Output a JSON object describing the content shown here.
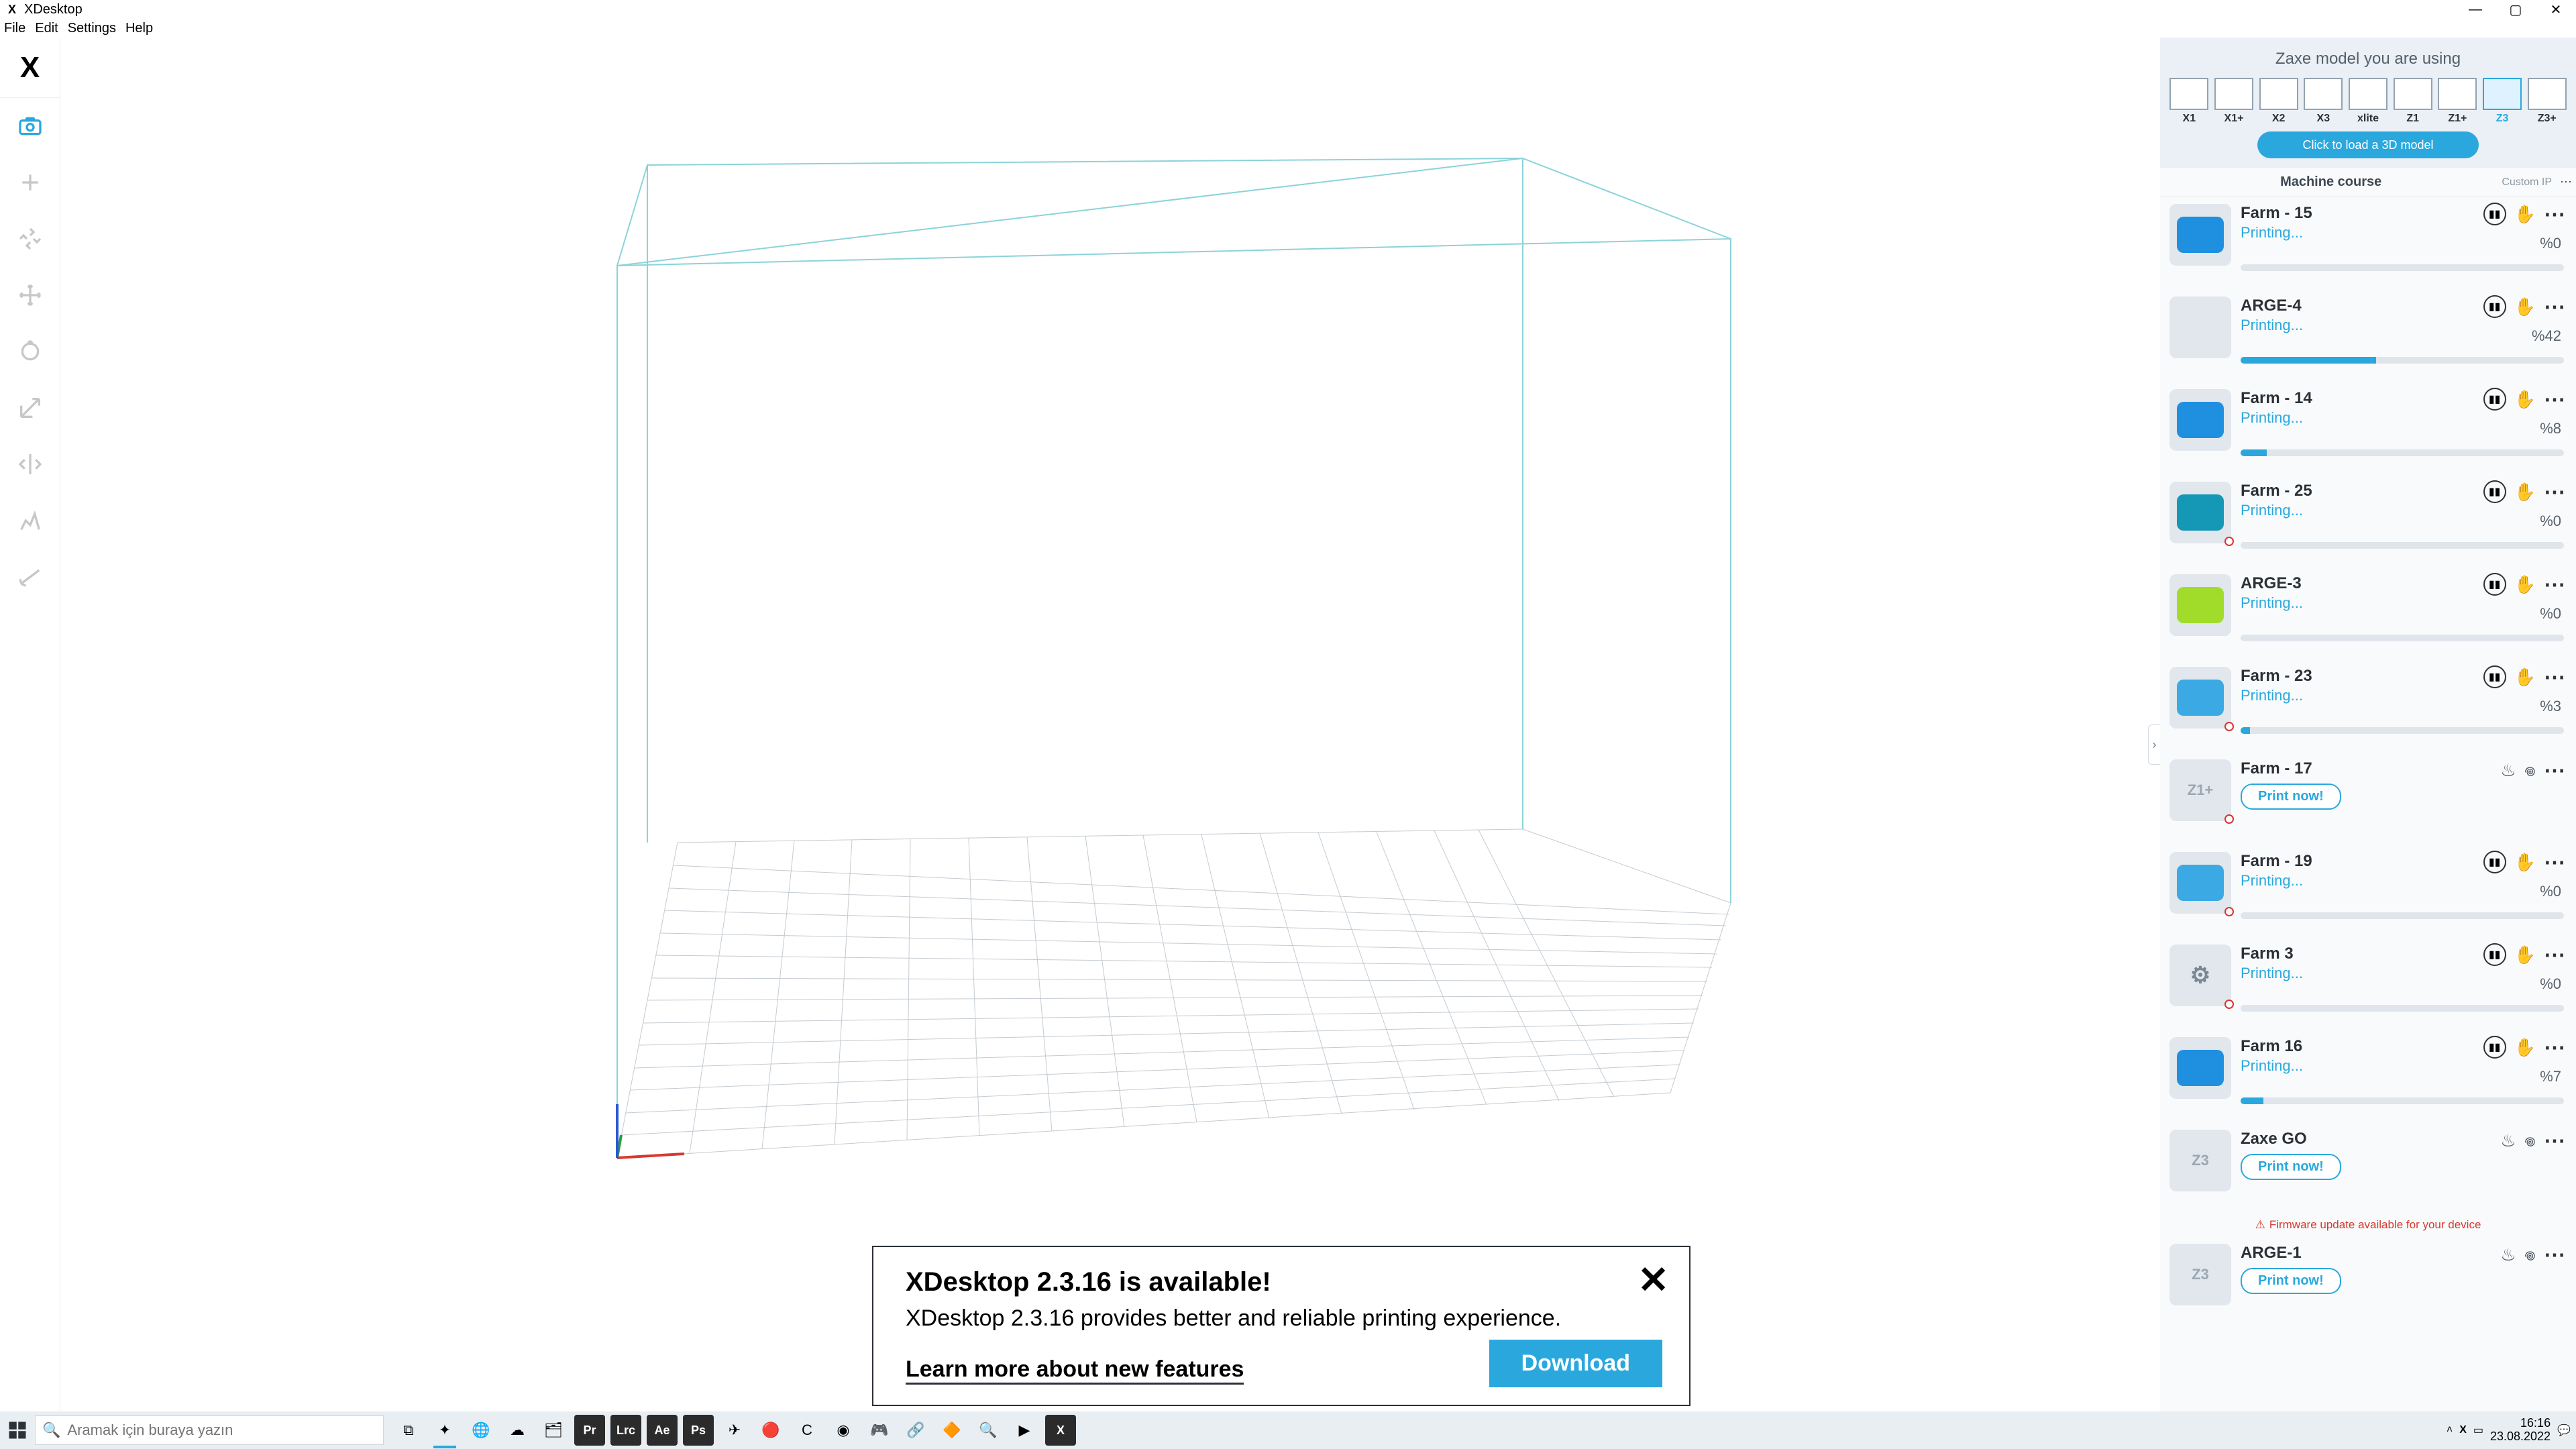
{
  "window": {
    "title": "XDesktop"
  },
  "menu": {
    "file": "File",
    "edit": "Edit",
    "settings": "Settings",
    "help": "Help"
  },
  "sidepanel": {
    "header": "Zaxe model you are using",
    "models": [
      "X1",
      "X1+",
      "X2",
      "X3",
      "xlite",
      "Z1",
      "Z1+",
      "Z3",
      "Z3+"
    ],
    "selected": "Z3",
    "load_button": "Click to load a 3D model",
    "course_label": "Machine course",
    "custom_ip": "Custom IP",
    "print_now": "Print now!",
    "firmware_warning": "Firmware update available for your device"
  },
  "machines": [
    {
      "name": "Farm - 15",
      "status": "Printing...",
      "progress": 0,
      "pct": "%0",
      "thumb": "blue",
      "actions": "pause-hand",
      "dot": false
    },
    {
      "name": "ARGE-4",
      "status": "Printing...",
      "progress": 42,
      "pct": "%42",
      "thumb": "none",
      "actions": "pause-hand",
      "dot": false
    },
    {
      "name": "Farm - 14",
      "status": "Printing...",
      "progress": 8,
      "pct": "%8",
      "thumb": "blue",
      "actions": "pause-hand",
      "dot": false
    },
    {
      "name": "Farm - 25",
      "status": "Printing...",
      "progress": 0,
      "pct": "%0",
      "thumb": "teal",
      "actions": "pause-hand",
      "dot": true
    },
    {
      "name": "ARGE-3",
      "status": "Printing...",
      "progress": 0,
      "pct": "%0",
      "thumb": "green",
      "actions": "pause-hand",
      "dot": false
    },
    {
      "name": "Farm - 23",
      "status": "Printing...",
      "progress": 3,
      "pct": "%3",
      "thumb": "sky",
      "actions": "pause-hand",
      "dot": true
    },
    {
      "name": "Farm - 17",
      "status": "idle",
      "progress": null,
      "pct": "",
      "thumb": "label",
      "thumb_label": "Z1+",
      "actions": "heat",
      "dot": true
    },
    {
      "name": "Farm - 19",
      "status": "Printing...",
      "progress": 0,
      "pct": "%0",
      "thumb": "sky",
      "actions": "pause-hand",
      "dot": true
    },
    {
      "name": "Farm 3",
      "status": "Printing...",
      "progress": 0,
      "pct": "%0",
      "thumb": "gear",
      "actions": "pause-hand",
      "dot": true
    },
    {
      "name": "Farm 16",
      "status": "Printing...",
      "progress": 7,
      "pct": "%7",
      "thumb": "blue",
      "actions": "pause-hand",
      "dot": false
    },
    {
      "name": "Zaxe GO",
      "status": "idle",
      "progress": null,
      "pct": "",
      "thumb": "label",
      "thumb_label": "Z3",
      "actions": "heat",
      "dot": false,
      "fw": true
    },
    {
      "name": "ARGE-1",
      "status": "idle",
      "progress": null,
      "pct": "",
      "thumb": "label",
      "thumb_label": "Z3",
      "actions": "heat",
      "dot": false
    }
  ],
  "toast": {
    "title": "XDesktop 2.3.16 is available!",
    "body": "XDesktop 2.3.16 provides better and reliable printing experience.",
    "learn": "Learn more about new features",
    "download": "Download"
  },
  "taskbar": {
    "search_placeholder": "Aramak için buraya yazın",
    "time": "16:16",
    "date": "23.08.2022",
    "icons": [
      "task-view",
      "multi",
      "chrome",
      "onedrive",
      "explorer",
      "Pr",
      "Lrc",
      "Ae",
      "Ps",
      "telegram",
      "opera",
      "edge",
      "edge2",
      "discord",
      "teamviewer",
      "figma",
      "everything",
      "potplayer",
      "xdesktop"
    ]
  },
  "colors": {
    "accent": "#2aa8de",
    "danger": "#d43a2f"
  }
}
